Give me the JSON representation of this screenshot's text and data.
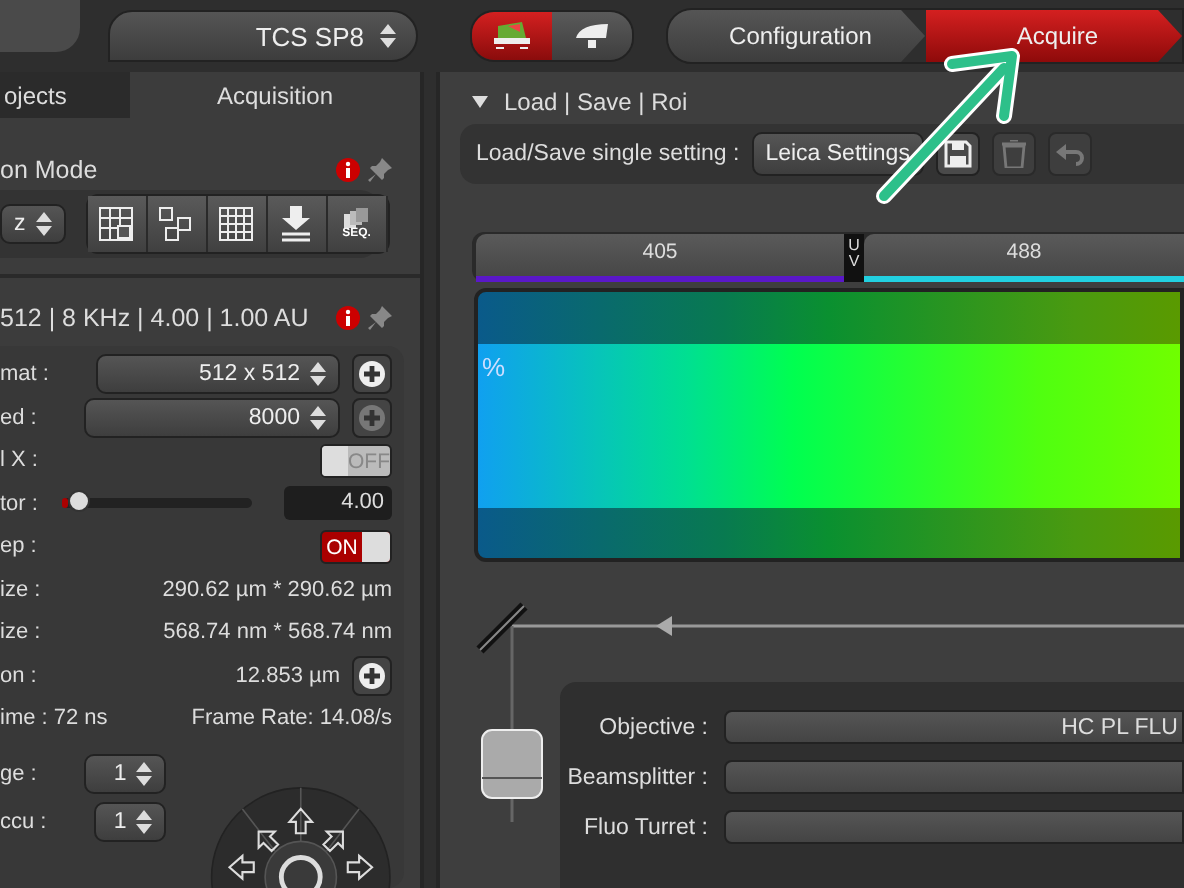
{
  "header": {
    "instrument_select": "TCS SP8",
    "mode_buttons": [
      {
        "kind": "laser",
        "selected": true
      },
      {
        "kind": "lamp",
        "selected": false
      }
    ],
    "workflow_tabs": [
      {
        "label": "Configuration",
        "selected": false
      },
      {
        "label": "Acquire",
        "selected": true
      }
    ]
  },
  "left_panel": {
    "tabs": [
      {
        "label": "ojects",
        "selected": false
      },
      {
        "label": "Acquisition",
        "selected": true
      }
    ],
    "mode": {
      "title": "on Mode",
      "scan_select": "z",
      "tool_buttons": [
        {
          "kind": "tile"
        },
        {
          "kind": "mark"
        },
        {
          "kind": "grid"
        },
        {
          "kind": "download"
        },
        {
          "kind": "sequence",
          "label": "SEQ."
        }
      ]
    },
    "scan_settings": {
      "summary": "512 | 8 KHz | 4.00 | 1.00 AU",
      "rows": [
        {
          "kind": "select",
          "label": "mat :",
          "value": "512 x 512",
          "plus_disabled": false
        },
        {
          "kind": "select",
          "label": "ed :",
          "value": "8000",
          "plus_disabled": true
        },
        {
          "kind": "toggle",
          "label": "l X :",
          "on": false,
          "text": "OFF"
        },
        {
          "kind": "slider",
          "label": "tor :",
          "level": 0.1,
          "value": "4.00"
        },
        {
          "kind": "toggle",
          "label": "ep :",
          "on": true,
          "text": "ON"
        },
        {
          "kind": "text",
          "label": "ize :",
          "value": "290.62 µm * 290.62 µm"
        },
        {
          "kind": "text",
          "label": "ize :",
          "value": "568.74 nm * 568.74 nm"
        },
        {
          "kind": "text",
          "label": "on :",
          "value": "12.853 µm",
          "plus_disabled": false
        },
        {
          "kind": "text",
          "label": "ime : 72 ns",
          "value": "Frame Rate: 14.08/s"
        }
      ],
      "averages": [
        {
          "label": "ge :",
          "value": "1"
        },
        {
          "label": "ccu :",
          "value": "1"
        }
      ]
    }
  },
  "right_panel": {
    "section": {
      "title": "Load | Save | Roi",
      "expanded": true
    },
    "load_row": {
      "label": "Load/Save single setting :",
      "value": "Leica Settings",
      "buttons": [
        {
          "kind": "save",
          "disabled": false
        },
        {
          "kind": "delete",
          "disabled": true
        },
        {
          "kind": "undo",
          "disabled": true
        }
      ]
    },
    "laser_lines": [
      {
        "label": "405",
        "color": "#5a18c8"
      },
      {
        "label": "488",
        "color": "#22d0e0"
      }
    ],
    "laser_divider": "UV",
    "spectrum_unit": "%",
    "light_path": [
      {
        "label": "Objective :",
        "value": "HC PL FLU"
      },
      {
        "label": "Beamsplitter :"
      },
      {
        "label": "Fluo Turret :"
      }
    ]
  }
}
